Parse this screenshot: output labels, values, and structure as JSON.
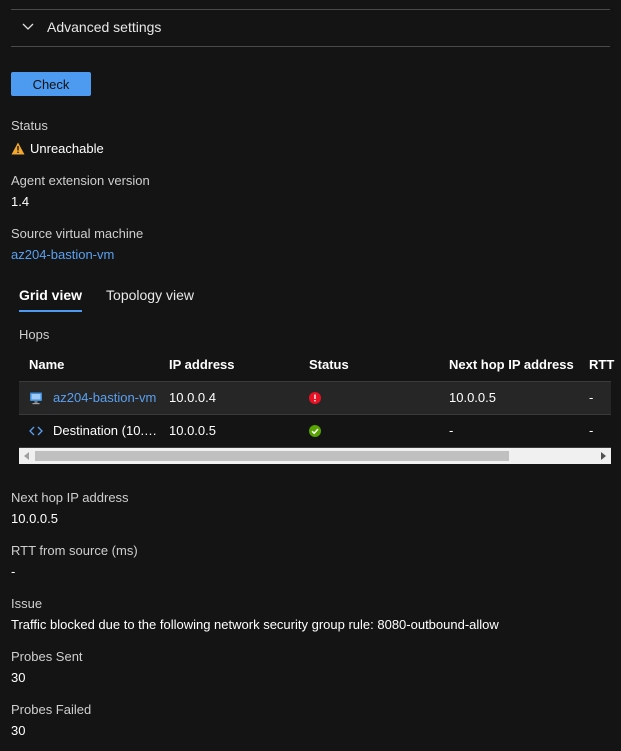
{
  "advanced": {
    "label": "Advanced settings"
  },
  "check_button": {
    "label": "Check"
  },
  "status": {
    "label": "Status",
    "value": "Unreachable"
  },
  "agent": {
    "label": "Agent extension version",
    "value": "1.4"
  },
  "source_vm": {
    "label": "Source virtual machine",
    "value": "az204-bastion-vm"
  },
  "tabs": [
    {
      "label": "Grid view",
      "active": true
    },
    {
      "label": "Topology view",
      "active": false
    }
  ],
  "hops": {
    "label": "Hops",
    "columns": [
      "Name",
      "IP address",
      "Status",
      "Next hop IP address",
      "RTT"
    ],
    "rows": [
      {
        "name": "az204-bastion-vm",
        "ip": "10.0.0.4",
        "status": "error",
        "next_hop": "10.0.0.5",
        "rtt": "-"
      },
      {
        "name": "Destination (10.…",
        "ip": "10.0.0.5",
        "status": "success",
        "next_hop": "-",
        "rtt": "-"
      }
    ]
  },
  "details": {
    "next_hop": {
      "label": "Next hop IP address",
      "value": "10.0.0.5"
    },
    "rtt": {
      "label": "RTT from source (ms)",
      "value": "-"
    },
    "issue": {
      "label": "Issue",
      "value": "Traffic blocked due to the following network security group rule: 8080-outbound-allow"
    },
    "probes_sent": {
      "label": "Probes Sent",
      "value": "30"
    },
    "probes_failed": {
      "label": "Probes Failed",
      "value": "30"
    }
  },
  "colors": {
    "accent": "#4c9bf0",
    "link": "#5aa0f0",
    "error": "#e81123",
    "success": "#57a300",
    "warning": "#f2a72f"
  }
}
